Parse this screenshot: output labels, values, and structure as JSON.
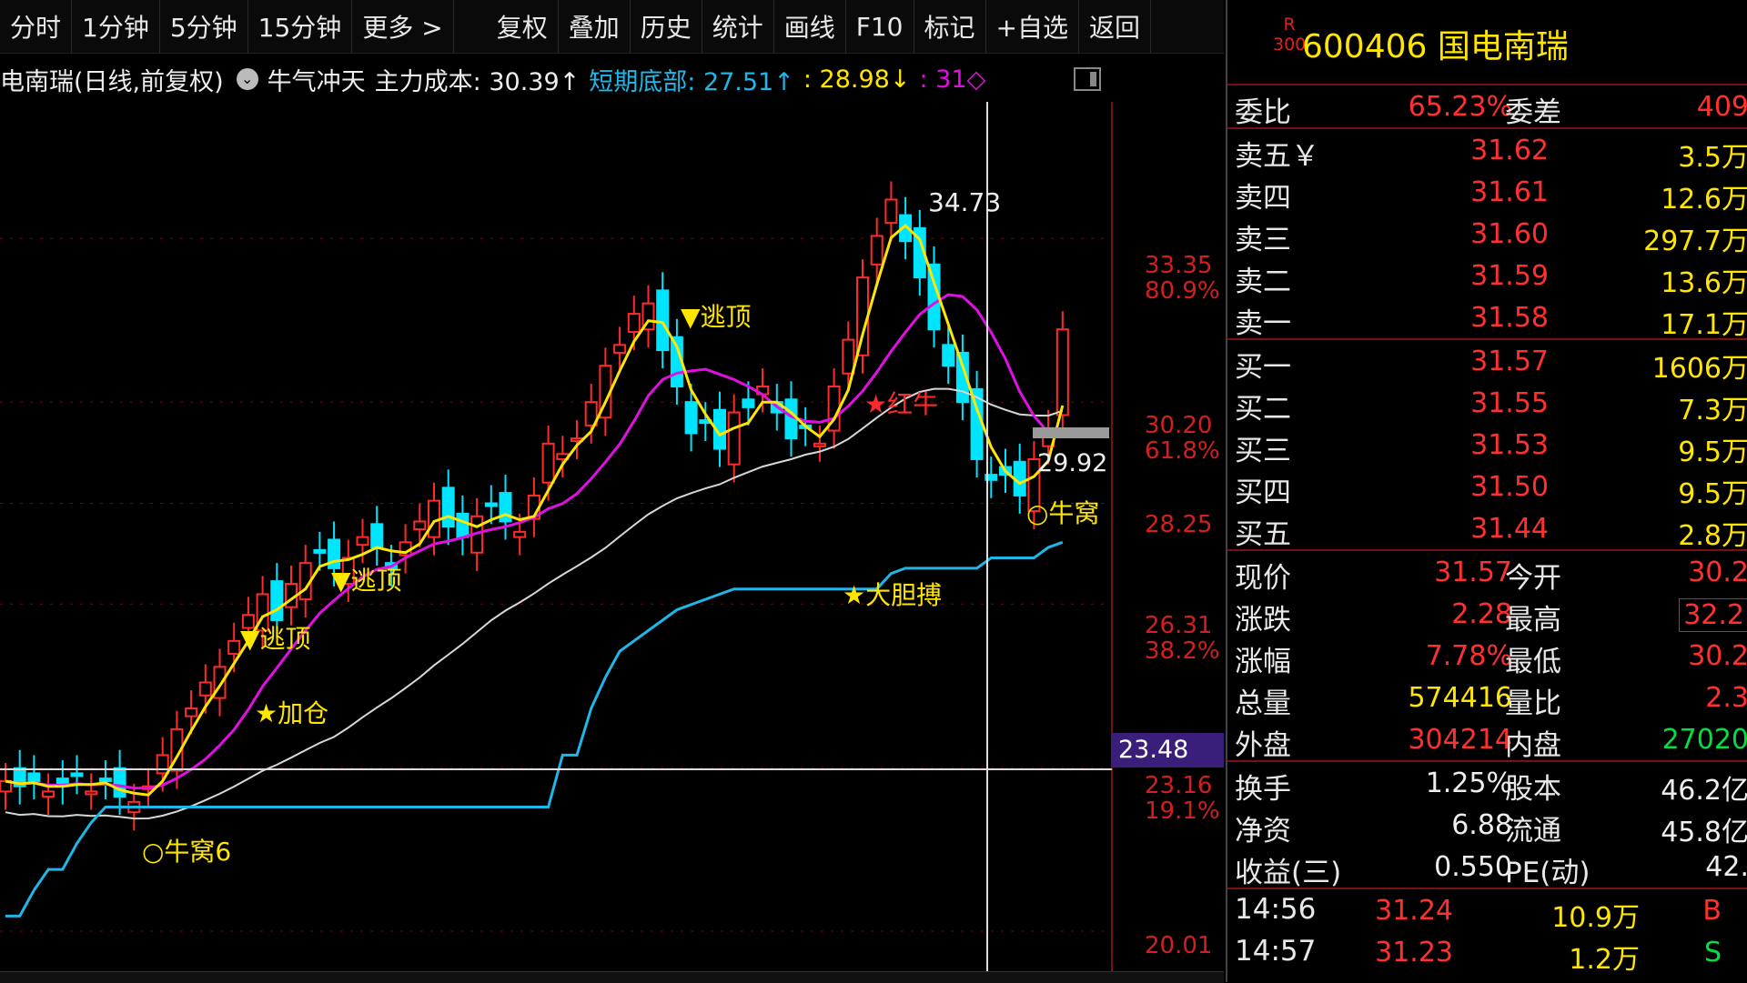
{
  "toolbar": {
    "items": [
      "分时",
      "1分钟",
      "5分钟",
      "15分钟",
      "更多 >",
      "复权",
      "叠加",
      "历史",
      "统计",
      "画线",
      "F10",
      "标记",
      "+自选",
      "返回"
    ]
  },
  "inforow": {
    "title": "电南瑞(日线,前复权)",
    "indicator": "牛气冲天",
    "cost_label": "主力成本: 30.39↑",
    "bottom_label": "短期底部: 27.51↑",
    "v3": ": 28.98↓",
    "v4": ": 31◇"
  },
  "axis": {
    "p1": "33.35",
    "pct1": "80.9%",
    "p2": "30.20",
    "pct2": "61.8%",
    "p3": "28.25",
    "p4": "26.31",
    "pct4": "38.2%",
    "p5": "23.16",
    "pct5": "19.1%",
    "p6": "20.01",
    "cross_value": "23.48"
  },
  "annotations": {
    "peak": "34.73",
    "last": "29.92",
    "escape1": "▼逃顶",
    "escape2": "▼逃顶",
    "escape3": "▼逃顶",
    "add": "★加仓",
    "redbull": "★红牛",
    "bold": "★大胆搏",
    "nest1": "○牛窝",
    "nest2": "○牛窝6"
  },
  "quote": {
    "badge_top": "R",
    "badge_bottom": "300",
    "code_name": "600406 国电南瑞",
    "weibi_label": "委比",
    "weibi": "65.23%",
    "weicha_label": "委差",
    "weicha": "409",
    "sells": [
      {
        "label": "卖五￥",
        "price": "31.62",
        "vol": "3.5万"
      },
      {
        "label": "卖四",
        "price": "31.61",
        "vol": "12.6万"
      },
      {
        "label": "卖三",
        "price": "31.60",
        "vol": "297.7万"
      },
      {
        "label": "卖二",
        "price": "31.59",
        "vol": "13.6万"
      },
      {
        "label": "卖一",
        "price": "31.58",
        "vol": "17.1万"
      }
    ],
    "buys": [
      {
        "label": "买一",
        "price": "31.57",
        "vol": "1606万"
      },
      {
        "label": "买二",
        "price": "31.55",
        "vol": "7.3万"
      },
      {
        "label": "买三",
        "price": "31.53",
        "vol": "9.5万"
      },
      {
        "label": "买四",
        "price": "31.50",
        "vol": "9.5万"
      },
      {
        "label": "买五",
        "price": "31.44",
        "vol": "2.8万"
      }
    ],
    "stats1": [
      {
        "l1": "现价",
        "v1": "31.57",
        "c1": "red",
        "l2": "今开",
        "v2": "30.2",
        "c2": "red"
      },
      {
        "l1": "涨跌",
        "v1": "2.28",
        "c1": "red",
        "l2": "最高",
        "v2": "32.2",
        "c2": "red"
      },
      {
        "l1": "涨幅",
        "v1": "7.78%",
        "c1": "red",
        "l2": "最低",
        "v2": "30.2",
        "c2": "red"
      },
      {
        "l1": "总量",
        "v1": "574416",
        "c1": "yel",
        "l2": "量比",
        "v2": "2.3",
        "c2": "red"
      },
      {
        "l1": "外盘",
        "v1": "304214",
        "c1": "red",
        "l2": "内盘",
        "v2": "27020",
        "c2": "grn"
      }
    ],
    "stats2": [
      {
        "l1": "换手",
        "v1": "1.25%",
        "l2": "股本",
        "v2": "46.2亿"
      },
      {
        "l1": "净资",
        "v1": "6.88",
        "l2": "流通",
        "v2": "45.8亿"
      },
      {
        "l1": "收益(三)",
        "v1": "0.550",
        "l2": "PE(动)",
        "v2": "42."
      }
    ],
    "ticks": [
      {
        "time": "14:56",
        "price": "31.24",
        "vol": "10.9万",
        "side": "B"
      },
      {
        "time": "14:57",
        "price": "31.23",
        "vol": "1.2万",
        "side": "S"
      }
    ]
  },
  "colors": {
    "up": "#ff2a2a",
    "down": "#00e5ff",
    "ma5": "#ffe600",
    "ma20": "#e010e0",
    "ma60": "#d8d8d8",
    "support": "#1fb6e8"
  }
}
